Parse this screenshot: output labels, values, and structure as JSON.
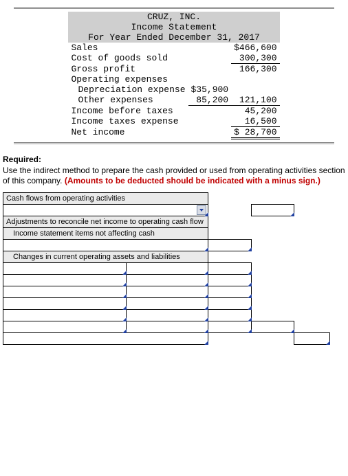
{
  "income_statement": {
    "company": "CRUZ, INC.",
    "title": "Income Statement",
    "period": "For Year Ended December 31, 2017",
    "lines": {
      "sales_label": "Sales",
      "sales_val": "$466,600",
      "cogs_label": "Cost of goods sold",
      "cogs_val": "300,300",
      "gp_label": "Gross profit",
      "gp_val": "166,300",
      "opex_label": "Operating expenses",
      "dep_label": "Depreciation expense",
      "dep_val": "$35,900",
      "other_label": "Other expenses",
      "other_val": "85,200",
      "opex_total": "121,100",
      "ibt_label": "Income before taxes",
      "ibt_val": "45,200",
      "tax_label": "Income taxes expense",
      "tax_val": "16,500",
      "ni_label": "Net income",
      "ni_val": "$ 28,700"
    }
  },
  "required": {
    "heading": "Required:",
    "body": "Use the indirect method to prepare the cash provided or used from operating activities section of this company. ",
    "red_note": "(Amounts to be deducted should be indicated with a minus sign.)"
  },
  "cf": {
    "ops_header": "Cash flows from operating activities",
    "adj_header": "Adjustments to reconcile net income to operating cash flow",
    "is_items": "Income statement items not affecting cash",
    "changes": "Changes in current operating assets and liabilities"
  },
  "chart_data": {
    "type": "table",
    "title": "CRUZ, INC. Income Statement — For Year Ended December 31, 2017",
    "rows": [
      {
        "label": "Sales",
        "value": 466600
      },
      {
        "label": "Cost of goods sold",
        "value": 300300
      },
      {
        "label": "Gross profit",
        "value": 166300
      },
      {
        "label": "Depreciation expense",
        "value": 35900
      },
      {
        "label": "Other expenses",
        "value": 85200
      },
      {
        "label": "Total operating expenses",
        "value": 121100
      },
      {
        "label": "Income before taxes",
        "value": 45200
      },
      {
        "label": "Income taxes expense",
        "value": 16500
      },
      {
        "label": "Net income",
        "value": 28700
      }
    ]
  }
}
